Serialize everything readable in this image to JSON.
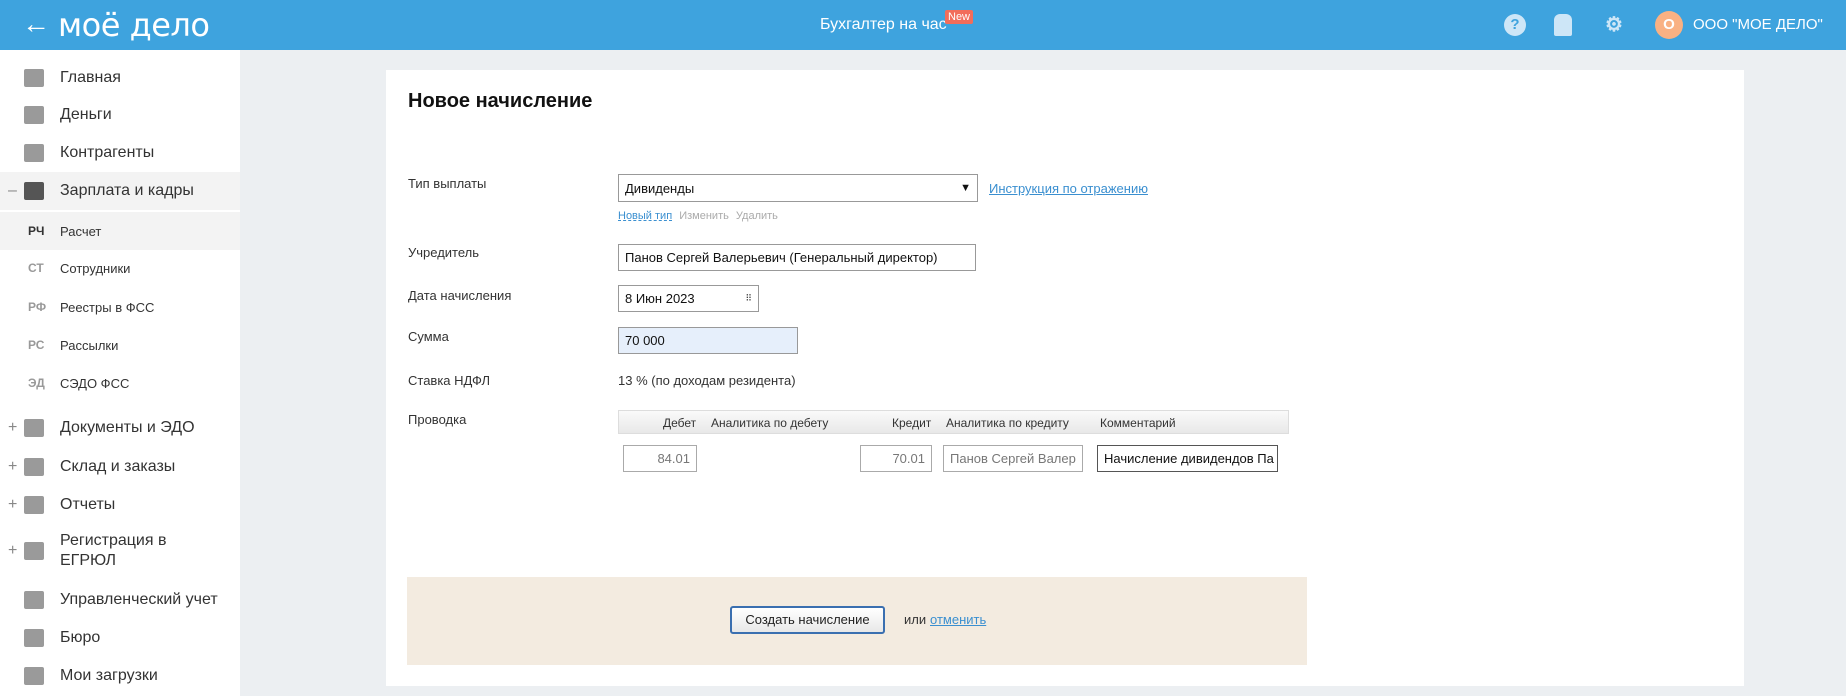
{
  "header": {
    "logo": "моё дело",
    "center": "Бухгалтер на час",
    "badge": "New",
    "avatar": "О",
    "org": "ООО \"МОЕ ДЕЛО\""
  },
  "sidebar": {
    "items": [
      {
        "label": "Главная"
      },
      {
        "label": "Деньги"
      },
      {
        "label": "Контрагенты"
      },
      {
        "label": "Зарплата и кадры",
        "toggle": "–"
      },
      {
        "abbr": "РЧ",
        "label": "Расчет"
      },
      {
        "abbr": "СТ",
        "label": "Сотрудники"
      },
      {
        "abbr": "РФ",
        "label": "Реестры в ФСС"
      },
      {
        "abbr": "РС",
        "label": "Рассылки"
      },
      {
        "abbr": "ЭД",
        "label": "СЭДО ФСС"
      },
      {
        "label": "Документы и ЭДО",
        "toggle": "+"
      },
      {
        "label": "Склад и заказы",
        "toggle": "+"
      },
      {
        "label": "Отчеты",
        "toggle": "+"
      },
      {
        "label": "Регистрация в ЕГРЮЛ",
        "toggle": "+"
      },
      {
        "label": "Управленческий учет"
      },
      {
        "label": "Бюро"
      },
      {
        "label": "Мои загрузки"
      }
    ]
  },
  "form": {
    "title": "Новое начисление",
    "payment_type_label": "Тип выплаты",
    "payment_type": "Дивиденды",
    "instruction_link": "Инструкция по отражению",
    "new_type": "Новый тип",
    "edit": "Изменить",
    "delete": "Удалить",
    "founder_label": "Учредитель",
    "founder": "Панов Сергей Валерьевич (Генеральный директор)",
    "date_label": "Дата начисления",
    "date": "8 Июн 2023",
    "sum_label": "Сумма",
    "sum": "70 000",
    "ndfl_label": "Ставка НДФЛ",
    "ndfl": "13 % (по доходам резидента)",
    "posting_label": "Проводка",
    "columns": [
      "Дебет",
      "Аналитика по дебету",
      "Кредит",
      "Аналитика по кредиту",
      "Комментарий"
    ],
    "row": {
      "debit": "84.01",
      "credit": "70.01",
      "credit_analytics": "Панов Сергей Валер",
      "comment": "Начисление дивидендов Па"
    },
    "create": "Создать начисление",
    "or": "или",
    "cancel": "отменить"
  }
}
